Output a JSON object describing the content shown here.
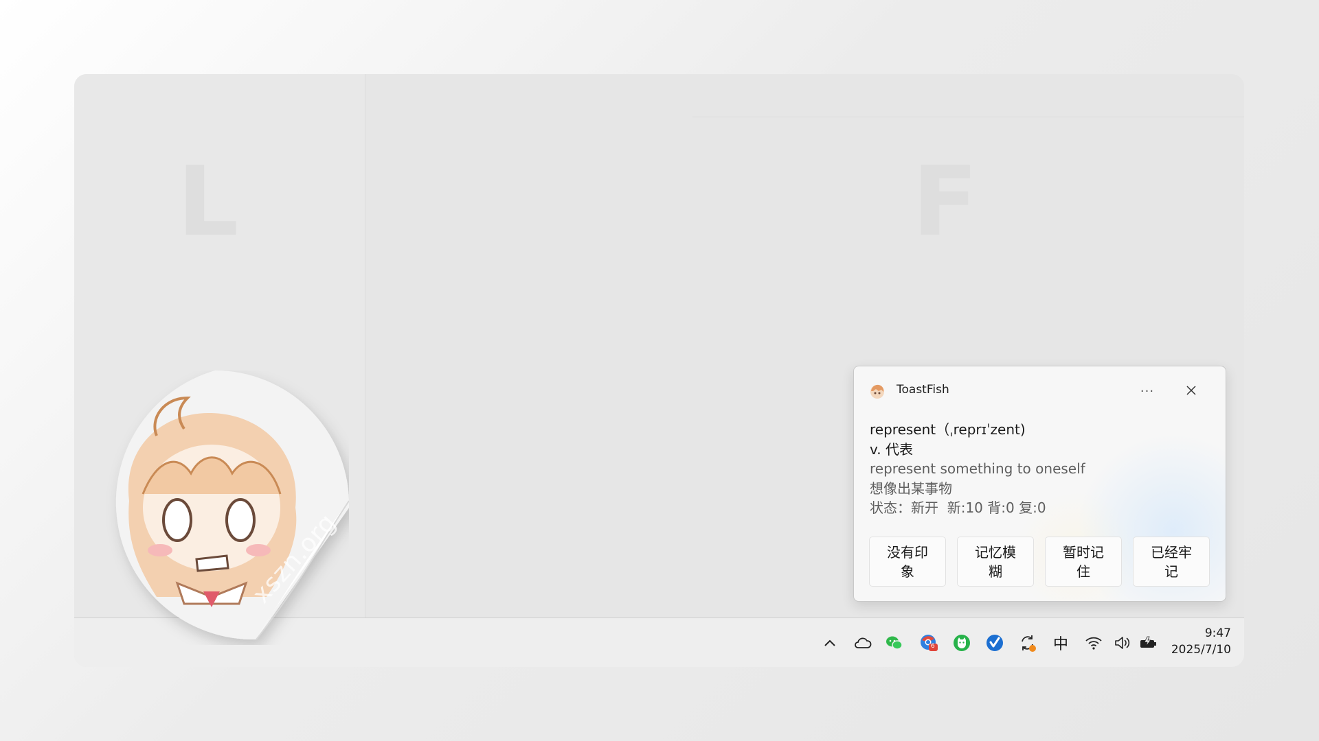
{
  "desktop": {
    "faint_letters": [
      "L",
      "F"
    ]
  },
  "toast": {
    "app_name": "ToastFish",
    "more_label": "···",
    "word_line": "represent（ˌreprɪˈzent)",
    "meaning_line": "v. 代表",
    "example_en": "represent something to oneself",
    "example_zh": "想像出某事物",
    "status_line": "状态：新开  新:10 背:0 复:0",
    "actions": [
      {
        "label": "没有印象"
      },
      {
        "label": "记忆模糊"
      },
      {
        "label": "暂时记住"
      },
      {
        "label": "已经牢记"
      }
    ]
  },
  "taskbar": {
    "tray_icons": [
      "chevron-up-icon",
      "onedrive-cloud-icon",
      "wechat-icon",
      "browser-badge-icon",
      "green-app-icon",
      "blue-check-app-icon",
      "sync-icon",
      "ime-icon",
      "wifi-icon",
      "volume-icon",
      "battery-icon"
    ],
    "ime_label": "中",
    "badge_label": "6",
    "clock_time": "9:47",
    "clock_date": "2025/7/10"
  },
  "watermark": {
    "text": "xszn.org"
  },
  "colors": {
    "accent_green": "#2fb84a",
    "accent_blue": "#1e7fd6",
    "badge_red": "#e0443a"
  }
}
